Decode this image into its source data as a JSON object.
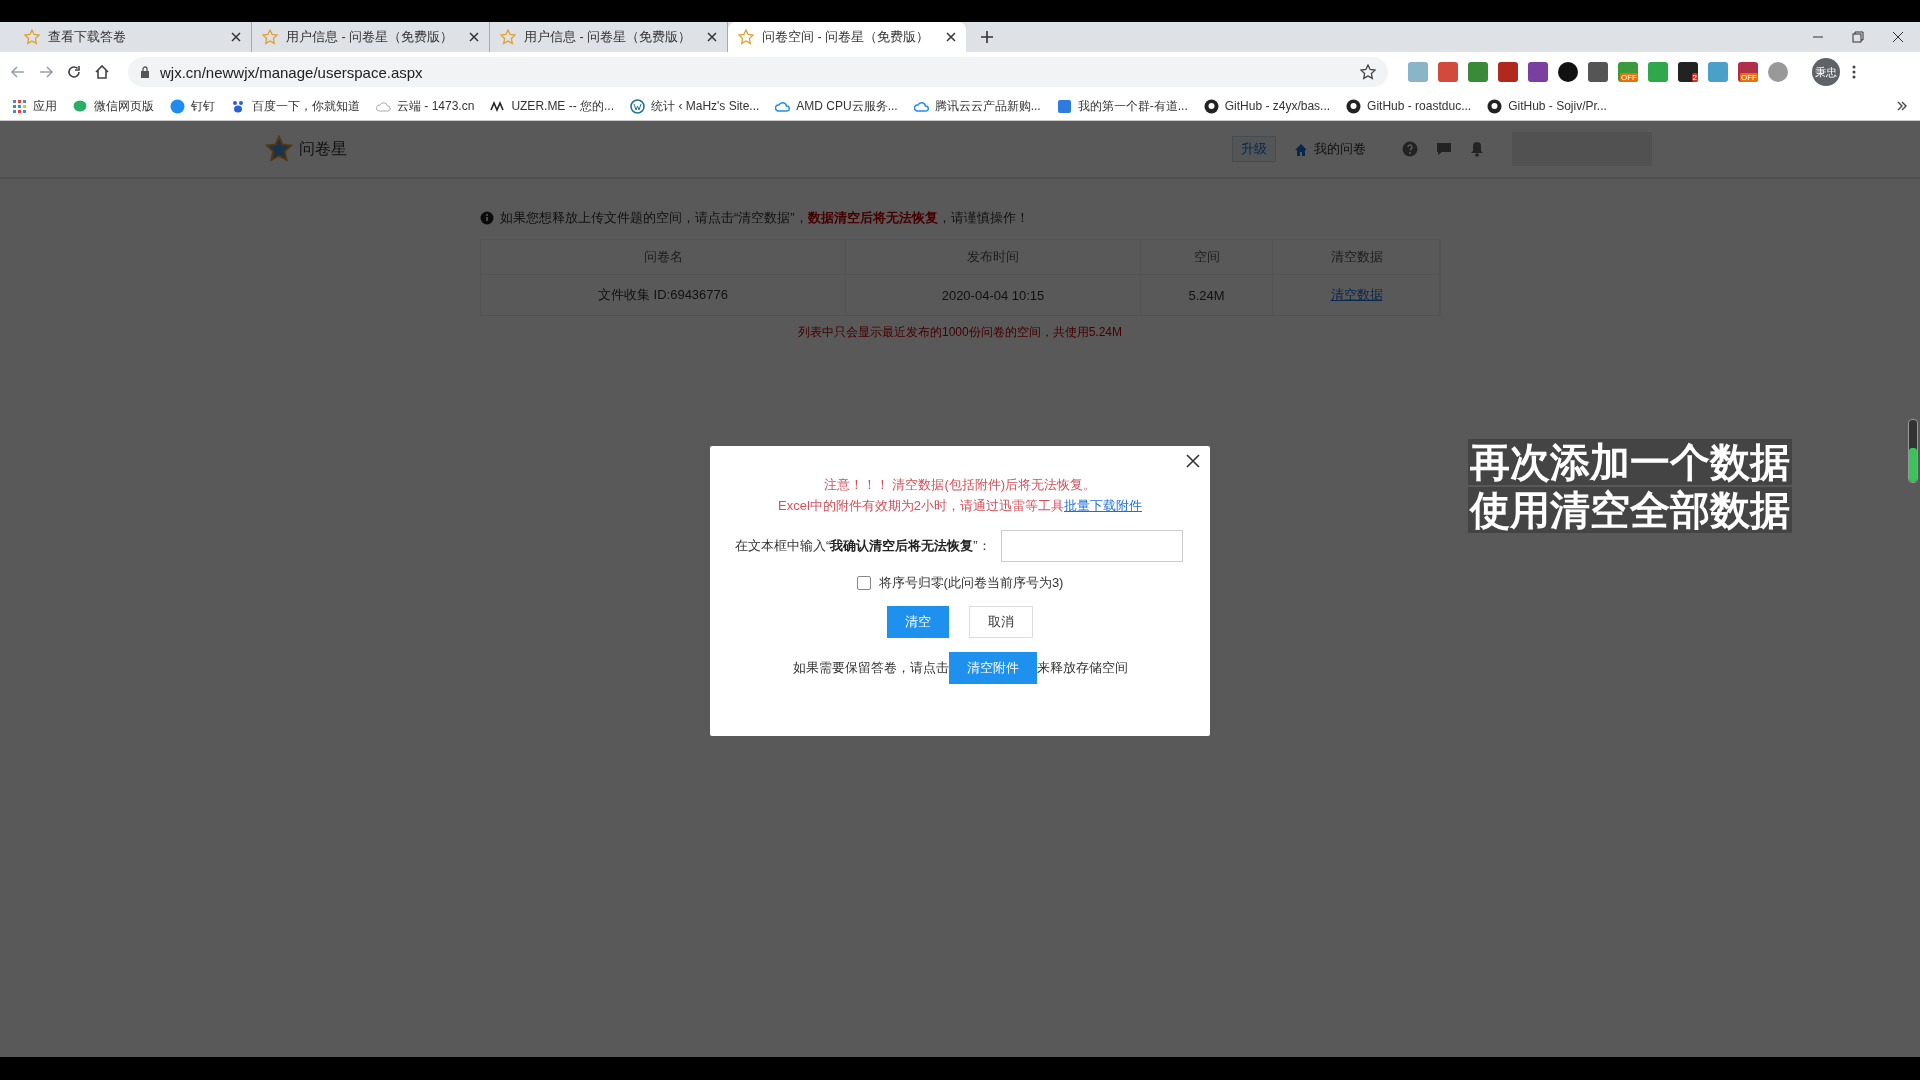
{
  "browser": {
    "tabs": [
      {
        "title": "查看下载答卷",
        "selected": false
      },
      {
        "title": "用户信息 - 问卷星（免费版）",
        "selected": false
      },
      {
        "title": "用户信息 - 问卷星（免费版）",
        "selected": false
      },
      {
        "title": "问卷空间 - 问卷星（免费版）",
        "selected": true
      }
    ],
    "url": "wjx.cn/newwjx/manage/userspace.aspx",
    "extensions": [
      {
        "kind": "plain"
      },
      {
        "kind": "plain"
      },
      {
        "kind": "plain"
      },
      {
        "kind": "plain"
      },
      {
        "kind": "plain"
      },
      {
        "kind": "plain"
      },
      {
        "kind": "plain"
      },
      {
        "kind": "badged",
        "badge": "OFF"
      },
      {
        "kind": "plain"
      },
      {
        "kind": "badged",
        "badge": "2"
      },
      {
        "kind": "plain"
      },
      {
        "kind": "badged",
        "badge": "OFF"
      },
      {
        "kind": "plain"
      }
    ],
    "avatar": "秉忠",
    "bookmarks": [
      {
        "label": "应用",
        "kind": "apps"
      },
      {
        "label": "微信网页版",
        "kind": "wechat"
      },
      {
        "label": "钉钉",
        "kind": "ding"
      },
      {
        "label": "百度一下，你就知道",
        "kind": "baidu"
      },
      {
        "label": "云端 - 1473.cn",
        "kind": "cloud"
      },
      {
        "label": "UZER.ME -- 您的...",
        "kind": "uzer"
      },
      {
        "label": "统计 ‹ MaHz's Site...",
        "kind": "wp"
      },
      {
        "label": "AMD CPU云服务...",
        "kind": "tcloud"
      },
      {
        "label": "腾讯云云产品新购...",
        "kind": "tcloud"
      },
      {
        "label": "我的第一个群-有道...",
        "kind": "note"
      },
      {
        "label": "GitHub - z4yx/bas...",
        "kind": "github"
      },
      {
        "label": "GitHub - roastduc...",
        "kind": "github"
      },
      {
        "label": "GitHub - Sojiv/Pr...",
        "kind": "github"
      }
    ]
  },
  "site": {
    "logo": "问卷星",
    "upgrade": "升级",
    "my_surveys": "我的问卷"
  },
  "notice": "如果您想释放上传文件题的空间，请点击“清空数据”，**数据清空后将无法恢复**，请谨慎操作！",
  "table": {
    "columns": [
      "问卷名",
      "发布时间",
      "空间",
      "清空数据"
    ],
    "rows": [
      {
        "name": "文件收集 ID:69436776",
        "time": "2020-04-04 10:15",
        "space": "5.24M",
        "action": "清空数据"
      }
    ]
  },
  "footnote": "列表中只会显示最近发布的1000份问卷的空间，共使用5.24M",
  "dialog": {
    "warning_1": "注意！！！ 清空数据(包括附件)后将无法恢复。",
    "warning_2": "Excel中的附件有效期为2小时，请通过迅雷等工具",
    "download_link": "批量下载附件",
    "confirm_label": "在文本框中输入“**我确认清空后将无法恢复**”：",
    "reset_checkbox": {
      "label": "将序号归零(此问卷当前序号为3)",
      "checked": false
    },
    "clear_button": "清空",
    "cancel_button": "取消",
    "hint_before": "如果需要保留答卷，请点击",
    "clear_attachments_button": "清空附件",
    "hint_after": "来释放存储空间"
  },
  "caption": [
    "再次添加一个数据",
    "使用清空全部数据"
  ],
  "meter": {
    "level": 0.55
  }
}
